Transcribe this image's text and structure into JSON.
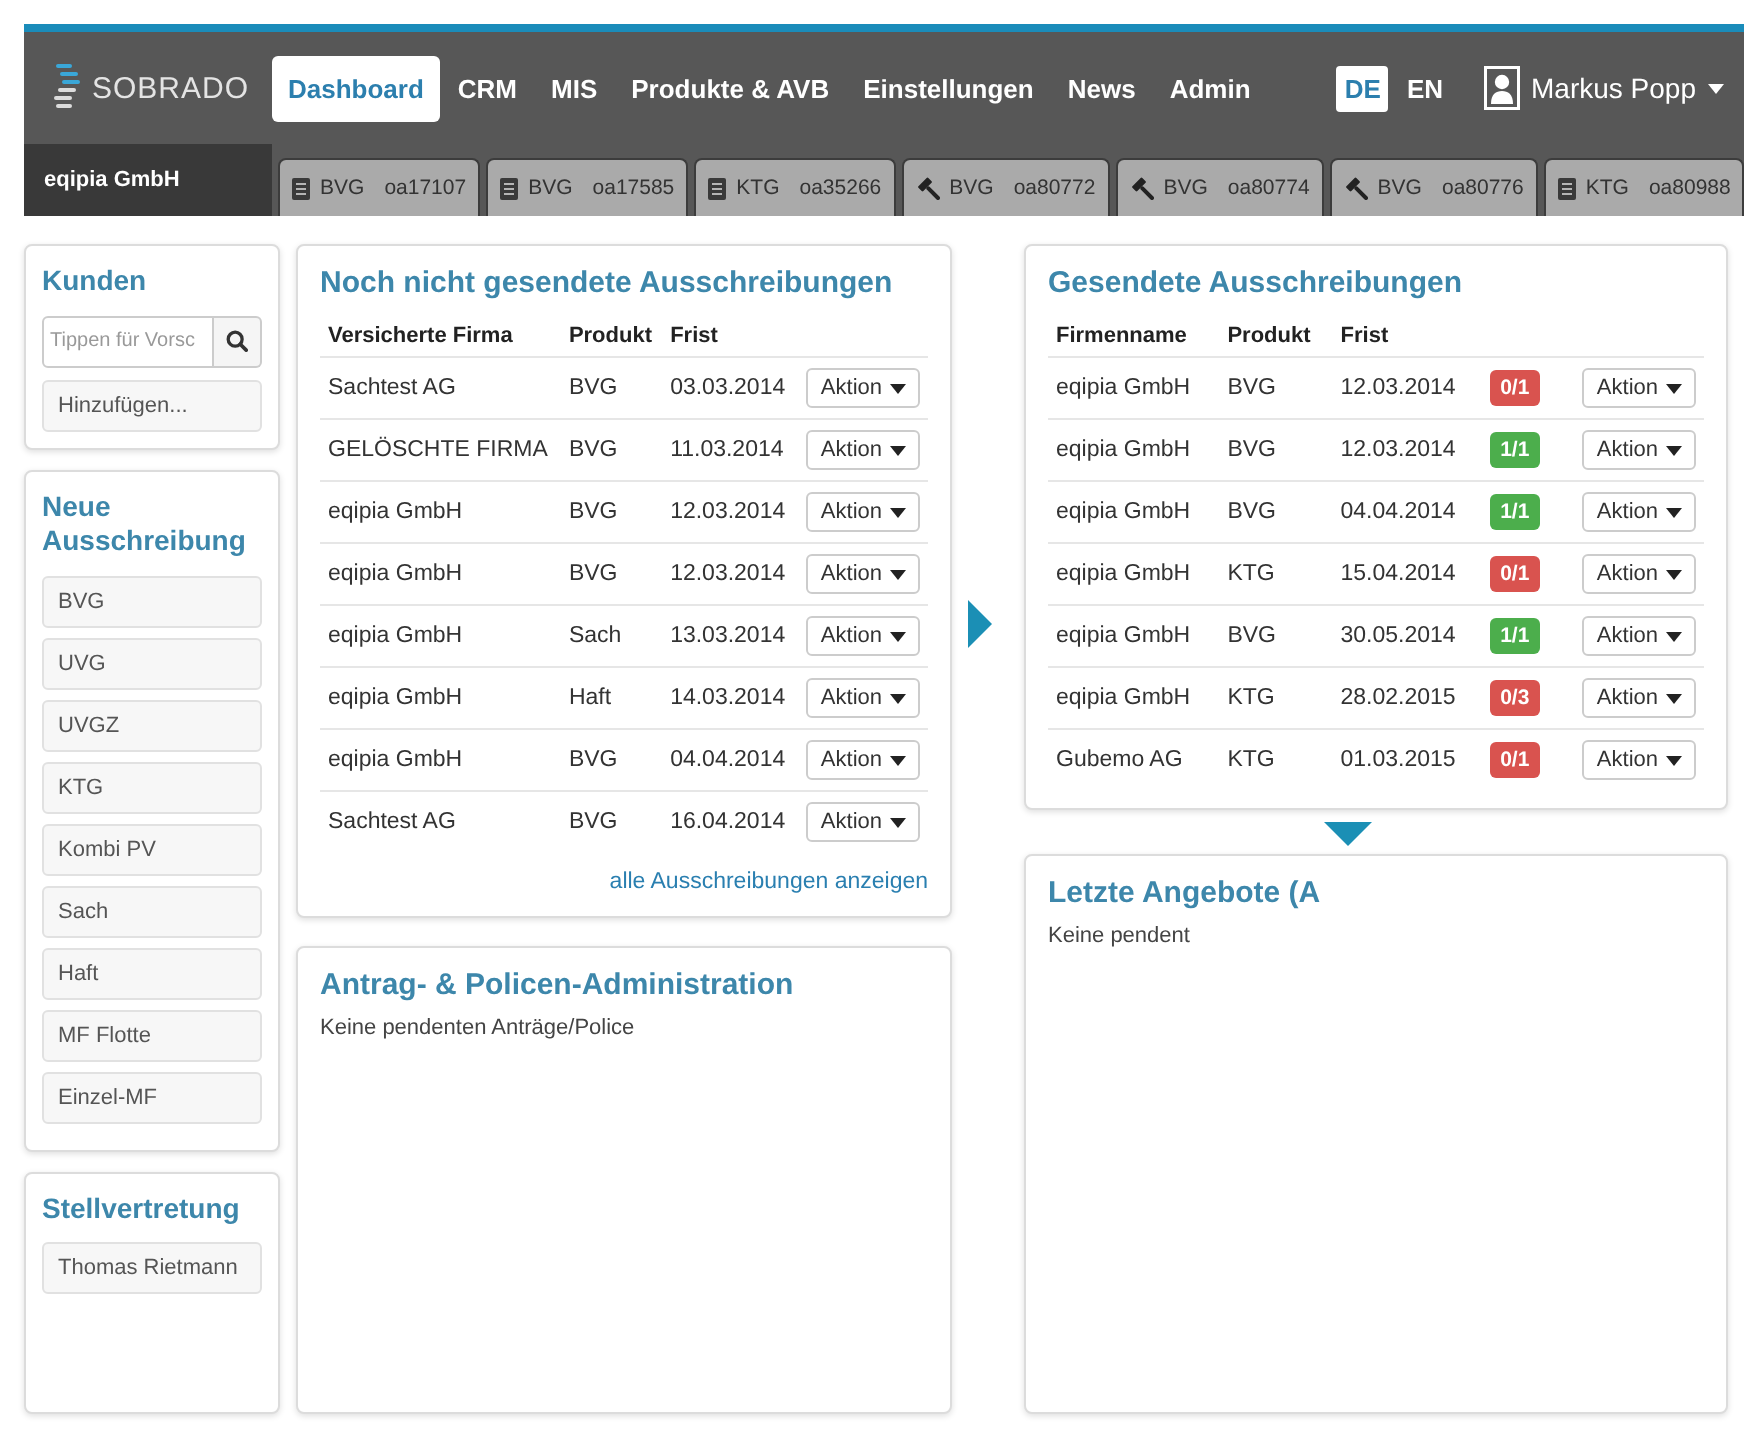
{
  "header": {
    "logo_text": "SOBRADO",
    "company": "eqipia GmbH",
    "nav": [
      {
        "label": "Dashboard",
        "selected": true
      },
      {
        "label": "CRM",
        "selected": false
      },
      {
        "label": "MIS",
        "selected": false
      },
      {
        "label": "Produkte & AVB",
        "selected": false
      },
      {
        "label": "Einstellungen",
        "selected": false
      },
      {
        "label": "News",
        "selected": false
      },
      {
        "label": "Admin",
        "selected": false
      }
    ],
    "languages": [
      {
        "label": "DE",
        "selected": true
      },
      {
        "label": "EN",
        "selected": false
      }
    ],
    "user": {
      "name": "Markus Popp"
    }
  },
  "recent_tabs": [
    {
      "kind": "list",
      "product": "BVG",
      "number": "oa17107"
    },
    {
      "kind": "list",
      "product": "BVG",
      "number": "oa17585"
    },
    {
      "kind": "list",
      "product": "KTG",
      "number": "oa35266"
    },
    {
      "kind": "gavel",
      "product": "BVG",
      "number": "oa80772"
    },
    {
      "kind": "gavel",
      "product": "BVG",
      "number": "oa80774"
    },
    {
      "kind": "gavel",
      "product": "BVG",
      "number": "oa80776"
    },
    {
      "kind": "list",
      "product": "KTG",
      "number": "oa80988"
    }
  ],
  "sidebar": {
    "customers": {
      "title": "Kunden",
      "search": {
        "placeholder": "Tippen für Vorsc"
      },
      "add_button": "Hinzufügen..."
    },
    "new_tender": {
      "title": "Neue Ausschreibung",
      "items": [
        "BVG",
        "UVG",
        "UVGZ",
        "KTG",
        "Kombi PV",
        "Sach",
        "Haft",
        "MF Flotte",
        "Einzel-MF"
      ]
    },
    "deputy": {
      "title": "Stellvertretung",
      "items": [
        "Thomas Rietmann"
      ]
    }
  },
  "unsent_tenders": {
    "title": "Noch nicht gesendete Ausschreibungen",
    "columns": [
      "Versicherte Firma",
      "Produkt",
      "Frist"
    ],
    "rows": [
      {
        "company": "Sachtest AG",
        "product": "BVG",
        "deadline": "03.03.2014",
        "action": "Aktion"
      },
      {
        "company": "GELÖSCHTE FIRMA",
        "product": "BVG",
        "deadline": "11.03.2014",
        "action": "Aktion"
      },
      {
        "company": "eqipia GmbH",
        "product": "BVG",
        "deadline": "12.03.2014",
        "action": "Aktion"
      },
      {
        "company": "eqipia GmbH",
        "product": "BVG",
        "deadline": "12.03.2014",
        "action": "Aktion"
      },
      {
        "company": "eqipia GmbH",
        "product": "Sach",
        "deadline": "13.03.2014",
        "action": "Aktion"
      },
      {
        "company": "eqipia GmbH",
        "product": "Haft",
        "deadline": "14.03.2014",
        "action": "Aktion"
      },
      {
        "company": "eqipia GmbH",
        "product": "BVG",
        "deadline": "04.04.2014",
        "action": "Aktion"
      },
      {
        "company": "Sachtest AG",
        "product": "BVG",
        "deadline": "16.04.2014",
        "action": "Aktion"
      }
    ],
    "link": "alle Ausschreibungen anzeigen"
  },
  "applications": {
    "title": "Antrag- & Policen-Administration",
    "message": "Keine pendenten Anträge/Police"
  },
  "sent_tenders": {
    "title": "Gesendete Ausschreibungen",
    "columns": [
      "Firmenname",
      "Produkt",
      "Frist"
    ],
    "rows": [
      {
        "company": "eqipia GmbH",
        "product": "BVG",
        "deadline": "12.03.2014",
        "status": {
          "text": "0/1",
          "color": "#d9534f"
        },
        "action": "Aktion"
      },
      {
        "company": "eqipia GmbH",
        "product": "BVG",
        "deadline": "12.03.2014",
        "status": {
          "text": "1/1",
          "color": "#4cae4c"
        },
        "action": "Aktion"
      },
      {
        "company": "eqipia GmbH",
        "product": "BVG",
        "deadline": "04.04.2014",
        "status": {
          "text": "1/1",
          "color": "#4cae4c"
        },
        "action": "Aktion"
      },
      {
        "company": "eqipia GmbH",
        "product": "KTG",
        "deadline": "15.04.2014",
        "status": {
          "text": "0/1",
          "color": "#d9534f"
        },
        "action": "Aktion"
      },
      {
        "company": "eqipia GmbH",
        "product": "BVG",
        "deadline": "30.05.2014",
        "status": {
          "text": "1/1",
          "color": "#4cae4c"
        },
        "action": "Aktion"
      },
      {
        "company": "eqipia GmbH",
        "product": "KTG",
        "deadline": "28.02.2015",
        "status": {
          "text": "0/3",
          "color": "#d9534f"
        },
        "action": "Aktion"
      },
      {
        "company": "Gubemo AG",
        "product": "KTG",
        "deadline": "01.03.2015",
        "status": {
          "text": "0/1",
          "color": "#d9534f"
        },
        "action": "Aktion"
      }
    ]
  },
  "recent_offers": {
    "title": "Letzte Angebote (A",
    "message": "Keine pendent"
  }
}
